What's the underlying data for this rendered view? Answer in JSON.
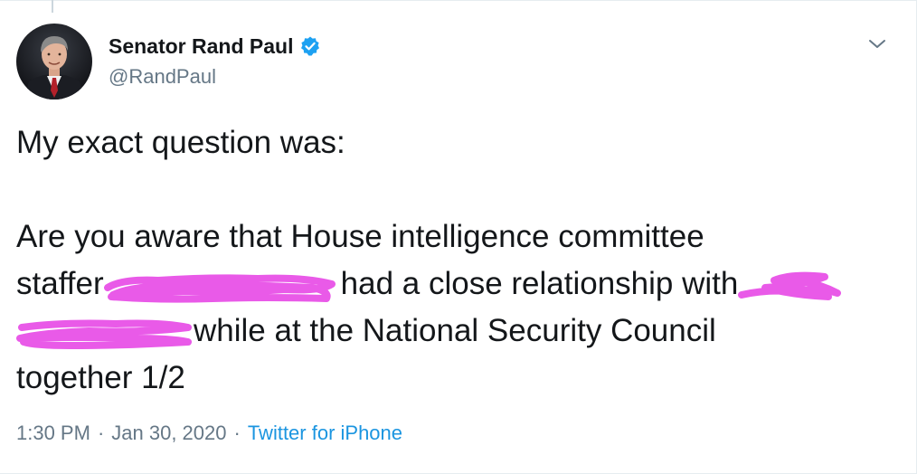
{
  "tweet": {
    "author": {
      "display_name": "Senator Rand Paul",
      "handle": "@RandPaul",
      "verified": true,
      "avatar_icon": "profile-photo"
    },
    "text_lines": {
      "l1": "My exact question was:",
      "l3": "Are you aware that House intelligence committee",
      "l4a": "staffer",
      "l4b": "had a close relationship with",
      "l5b": "while at the National Security Council",
      "l6": "together 1/2"
    },
    "time": "1:30 PM",
    "separator": "·",
    "date": "Jan 30, 2020",
    "source": "Twitter for iPhone"
  },
  "colors": {
    "accent": "#1da1f2",
    "source_link": "#1b95e0",
    "muted_text": "#657786",
    "redaction": "#e95ae8"
  },
  "icons": {
    "verified": "verified-badge-icon",
    "menu": "chevron-down-icon"
  }
}
